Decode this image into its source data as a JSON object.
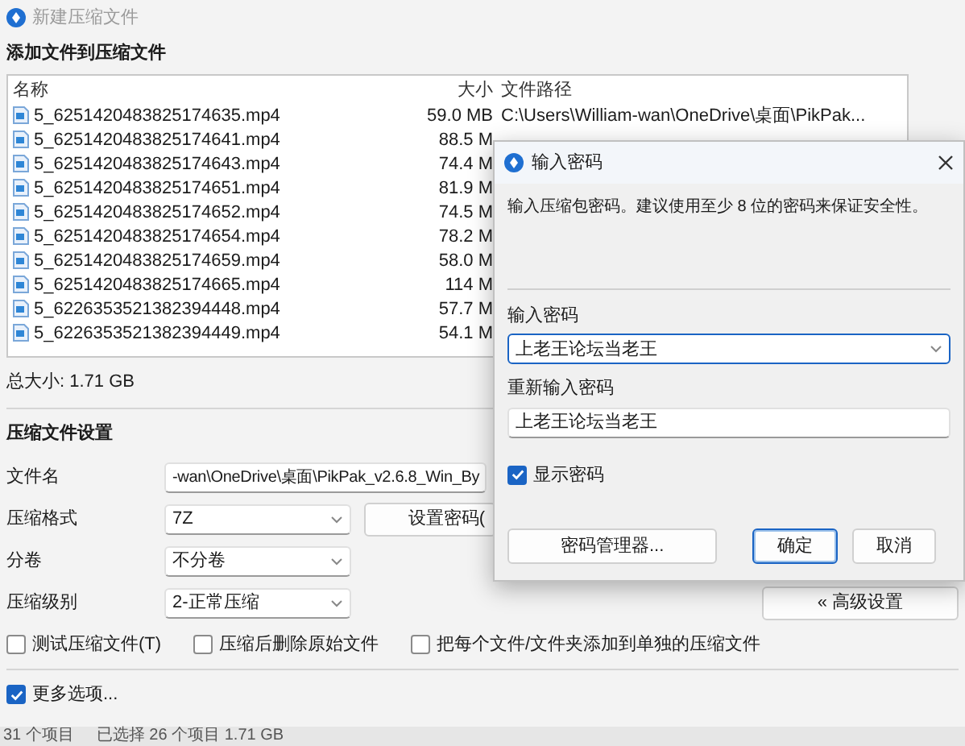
{
  "main_window": {
    "title": "新建压缩文件"
  },
  "section_title": "添加文件到压缩文件",
  "file_list": {
    "columns": [
      "名称",
      "大小",
      "文件路径"
    ],
    "rows": [
      {
        "name": "5_6251420483825174635.mp4",
        "size": "59.0 MB",
        "path": "C:\\Users\\William-wan\\OneDrive\\桌面\\PikPak..."
      },
      {
        "name": "5_6251420483825174641.mp4",
        "size": "88.5 M"
      },
      {
        "name": "5_6251420483825174643.mp4",
        "size": "74.4 M"
      },
      {
        "name": "5_6251420483825174651.mp4",
        "size": "81.9 M"
      },
      {
        "name": "5_6251420483825174652.mp4",
        "size": "74.5 M"
      },
      {
        "name": "5_6251420483825174654.mp4",
        "size": "78.2 M"
      },
      {
        "name": "5_6251420483825174659.mp4",
        "size": "58.0 M"
      },
      {
        "name": "5_6251420483825174665.mp4",
        "size": "114 M"
      },
      {
        "name": "5_6226353521382394448.mp4",
        "size": "57.7 M"
      },
      {
        "name": "5_6226353521382394449.mp4",
        "size": "54.1 M"
      }
    ]
  },
  "total_size": "总大小: 1.71 GB",
  "settings": {
    "title": "压缩文件设置",
    "fields": [
      {
        "kind": "text",
        "label": "文件名",
        "value": "-wan\\OneDrive\\桌面\\PikPak_v2.6.8_Win_By"
      },
      {
        "kind": "select",
        "label": "压缩格式",
        "value": "7Z"
      },
      {
        "kind": "select",
        "label": "分卷",
        "value": "不分卷"
      },
      {
        "kind": "select",
        "label": "压缩级别",
        "value": "2-正常压缩"
      }
    ],
    "set_password_button": "设置密码(",
    "advanced_button": "« 高级设置",
    "options": [
      {
        "label": "测试压缩文件(T)",
        "checked": false
      },
      {
        "label": "压缩后删除原始文件",
        "checked": false
      },
      {
        "label": "把每个文件/文件夹添加到单独的压缩文件",
        "checked": false
      }
    ]
  },
  "more_options": {
    "label": "更多选项...",
    "checked": true
  },
  "status_bar": [
    "31 个项目",
    "已选择 26 个项目 1.71 GB"
  ],
  "dialog": {
    "title": "输入密码",
    "message": "输入压缩包密码。建议使用至少 8 位的密码来保证安全性。",
    "password_label": "输入密码",
    "password_value": "上老王论坛当老王",
    "confirm_label": "重新输入密码",
    "confirm_value": "上老王论坛当老王",
    "show_password": {
      "label": "显示密码",
      "checked": true
    },
    "buttons": [
      {
        "kind": "manager",
        "label": "密码管理器..."
      },
      {
        "kind": "default",
        "label": "确定"
      },
      {
        "kind": "normal",
        "label": "取消"
      }
    ]
  }
}
